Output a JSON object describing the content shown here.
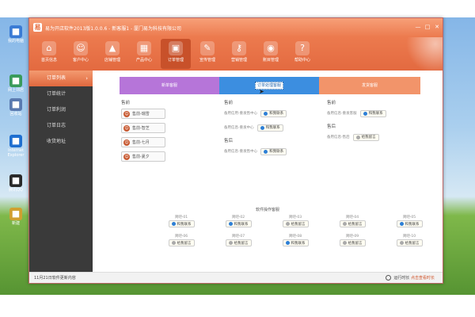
{
  "desktop": {
    "icons": [
      {
        "label": "我的电脑",
        "icon": "computer-icon",
        "color": "#3a7bd5"
      },
      {
        "label": "网上邻居",
        "icon": "network-icon",
        "color": "#3a9b5b"
      },
      {
        "label": "回收站",
        "icon": "recycle-bin-icon",
        "color": "#5a7ab0"
      },
      {
        "label": "Internet Explorer",
        "icon": "ie-icon",
        "color": "#1f6fd0"
      },
      {
        "label": "腾讯QQ",
        "icon": "qq-icon",
        "color": "#2a2a2a"
      },
      {
        "label": "新建",
        "icon": "folder-icon",
        "color": "#d0a030"
      }
    ]
  },
  "window": {
    "title": "易为开店软件2013版1.0.0.6 - 新客服1 - 厦门易为科技有限公司",
    "logo_char": "易",
    "controls": {
      "minimize": "—",
      "maximize": "□",
      "close": "✕"
    }
  },
  "toolbar": {
    "items": [
      {
        "label": "首页信息",
        "icon": "home-icon",
        "glyph": "⌂"
      },
      {
        "label": "客户中心",
        "icon": "user-icon",
        "glyph": "☺"
      },
      {
        "label": "店铺管理",
        "icon": "store-icon",
        "glyph": "▲"
      },
      {
        "label": "产品中心",
        "icon": "grid-icon",
        "glyph": "▦"
      },
      {
        "label": "订单管理",
        "icon": "order-icon",
        "glyph": "▣",
        "active": true
      },
      {
        "label": "宣传管理",
        "icon": "megaphone-icon",
        "glyph": "✎"
      },
      {
        "label": "营销管理",
        "icon": "key-icon",
        "glyph": "⚷"
      },
      {
        "label": "账目管理",
        "icon": "eye-icon",
        "glyph": "◉"
      },
      {
        "label": "帮助中心",
        "icon": "help-icon",
        "glyph": "?"
      }
    ],
    "accent": "#e8744a",
    "active_bg": "#c8512a"
  },
  "sidebar": {
    "items": [
      {
        "label": "订单列表",
        "active": true,
        "arrow": "›"
      },
      {
        "label": "订单统计"
      },
      {
        "label": "订单利润"
      },
      {
        "label": "订单日志"
      },
      {
        "label": "收货地址"
      }
    ]
  },
  "tabs": [
    {
      "label": "新单客服"
    },
    {
      "label": "订单处理客服",
      "active": true
    },
    {
      "label": "发货客服"
    }
  ],
  "main": {
    "col1": {
      "head": "售前",
      "contacts": [
        "售前-瑞雪",
        "售前-智芝",
        "售前-七月",
        "售前-夏夕"
      ]
    },
    "col2": {
      "head": "售前",
      "rows": [
        {
          "text": "备用信用-重发售中心",
          "status": "和我联系"
        },
        {
          "text": "备用信息-重发中心",
          "status": "和我联系"
        }
      ],
      "head2": "售后",
      "rows2": [
        {
          "text": "备用信息-重发售中心",
          "status": "和我联系"
        }
      ]
    },
    "col3": {
      "head": "售前",
      "rows": [
        {
          "text": "备用信息-重发客服",
          "status": "和我联系"
        }
      ],
      "head2": "售后",
      "rows2": [
        {
          "text": "备用信息-售后",
          "status": "给我留言"
        }
      ]
    },
    "ops": {
      "title": "软件操作客服",
      "items": [
        {
          "name": "简吧-01",
          "status": "和我联系",
          "online": true
        },
        {
          "name": "简吧-02",
          "status": "和我联系",
          "online": true
        },
        {
          "name": "简吧-03",
          "status": "给我留言",
          "online": false
        },
        {
          "name": "简吧-04",
          "status": "给我留言",
          "online": false
        },
        {
          "name": "简吧-05",
          "status": "和我联系",
          "online": true
        },
        {
          "name": "简吧-06",
          "status": "给我留言",
          "online": false
        },
        {
          "name": "简吧-07",
          "status": "给我留言",
          "online": false
        },
        {
          "name": "简吧-08",
          "status": "和我联系",
          "online": true
        },
        {
          "name": "简吧-09",
          "status": "给我留言",
          "online": false
        },
        {
          "name": "简吧-10",
          "status": "给我留言",
          "online": false
        }
      ]
    }
  },
  "statusbar": {
    "left": "11月21日软件更新内容",
    "right_label": "运行时长",
    "right_value": "点击查看时长"
  }
}
